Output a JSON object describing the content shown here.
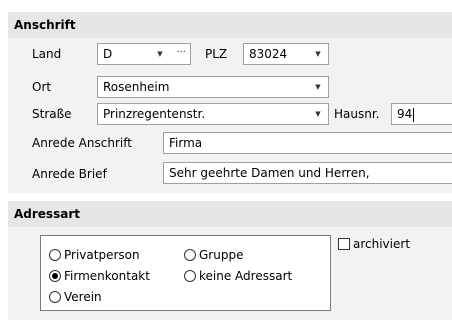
{
  "anschrift": {
    "header": "Anschrift",
    "land_label": "Land",
    "land_value": "D",
    "land_more": "···",
    "plz_label": "PLZ",
    "plz_value": "83024",
    "ort_label": "Ort",
    "ort_value": "Rosenheim",
    "strasse_label": "Straße",
    "strasse_value": "Prinzregentenstr.",
    "hausnr_label": "Hausnr.",
    "hausnr_value": "94",
    "anrede_anschrift_label": "Anrede Anschrift",
    "anrede_anschrift_value": "Firma",
    "anrede_brief_label": "Anrede Brief",
    "anrede_brief_value": "Sehr geehrte Damen und Herren,"
  },
  "adressart": {
    "header": "Adressart",
    "options": [
      {
        "label": "Privatperson",
        "checked": false
      },
      {
        "label": "Gruppe",
        "checked": false
      },
      {
        "label": "Firmenkontakt",
        "checked": true
      },
      {
        "label": "keine Adressart",
        "checked": false
      },
      {
        "label": "Verein",
        "checked": false
      }
    ],
    "archiviert_label": "archiviert",
    "archiviert_checked": false
  },
  "colors": {
    "header_bg": "#e6e6e6",
    "body_bg": "#f2f2f2",
    "field_border": "#a0a0a0"
  }
}
